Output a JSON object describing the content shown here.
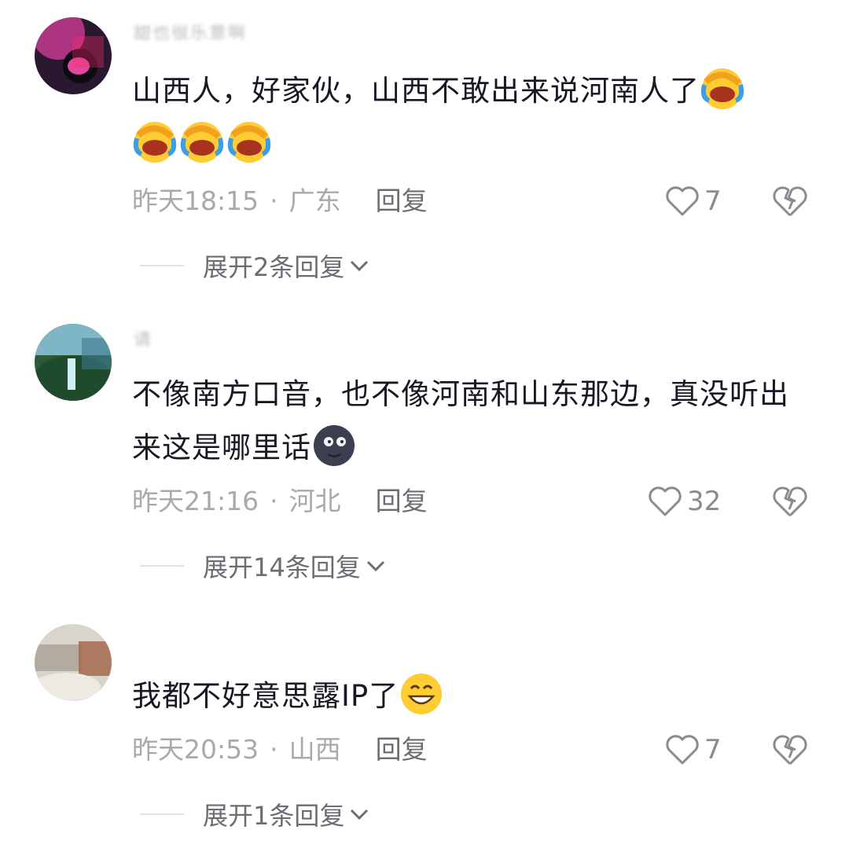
{
  "comments": [
    {
      "username": "甜也很乐意啊",
      "text_parts": [
        "山西人，好家伙，山西不敢出来说河南人了"
      ],
      "emoji_trailing": [
        "rofl-emoji",
        "rofl-emoji",
        "rofl-emoji",
        "rofl-emoji"
      ],
      "time": "昨天18:15",
      "location": "广东",
      "reply_label": "回复",
      "likes": "7",
      "expand_label": "展开2条回复"
    },
    {
      "username": "请",
      "text": "不像南方口音，也不像河南和山东那边，真没听出来这是哪里话",
      "emoji_trailing": [
        "new-moon-face-emoji"
      ],
      "time": "昨天21:16",
      "location": "河北",
      "reply_label": "回复",
      "likes": "32",
      "expand_label": "展开14条回复"
    },
    {
      "username": "",
      "text": "我都不好意思露IP了",
      "emoji_trailing": [
        "grinning-emoji"
      ],
      "time": "昨天20:53",
      "location": "山西",
      "reply_label": "回复",
      "likes": "7",
      "expand_label": "展开1条回复"
    }
  ],
  "separator": "·",
  "colors": {
    "text": "#161823",
    "meta": "#a8a9ad",
    "action": "#6b6d73"
  }
}
